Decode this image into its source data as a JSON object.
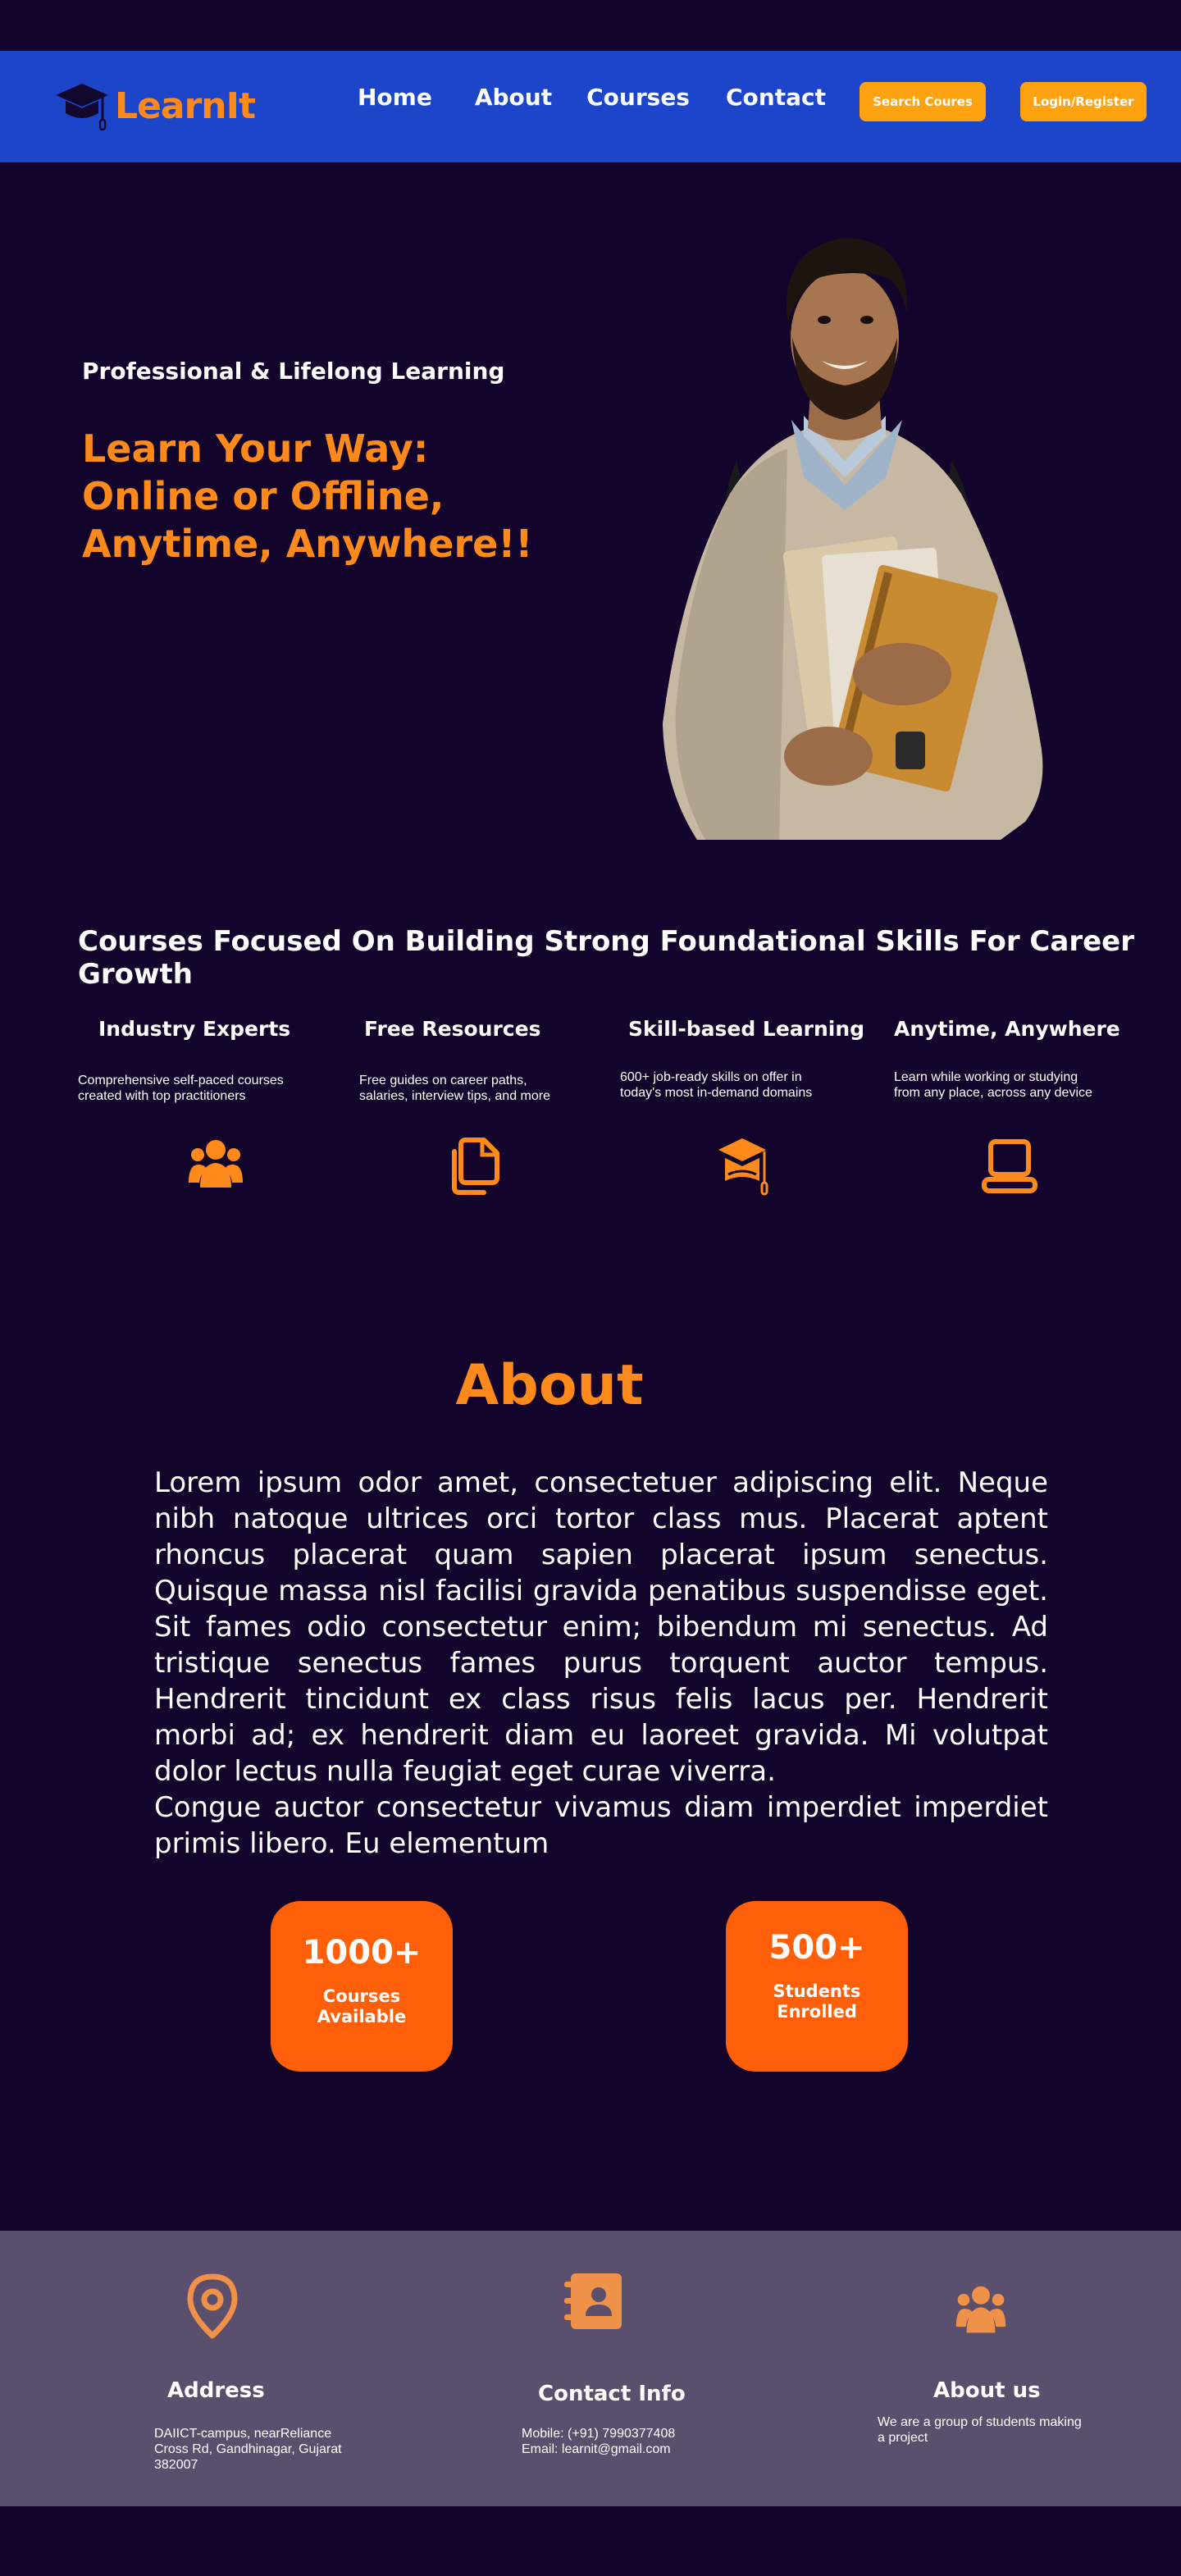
{
  "brand": {
    "name": "LearnIt",
    "accent": "#ff8a1c",
    "navbar_color": "#1c45c9",
    "background": "#12042b"
  },
  "nav": {
    "links": [
      "Home",
      "About",
      "Courses",
      "Contact"
    ],
    "search_button": "Search Coures",
    "login_button": "Login/Register"
  },
  "hero": {
    "subtitle": "Professional & Lifelong Learning",
    "title_lines": [
      "Learn Your Way:",
      "Online or Offline,",
      "Anytime, Anywhere!!"
    ],
    "image": "student-holding-books-photo"
  },
  "features": {
    "heading": "Courses Focused On Building Strong Foundational Skills For Career Growth",
    "items": [
      {
        "title": "Industry Experts",
        "desc_lines": [
          "Comprehensive self-paced courses",
          "created with top practitioners"
        ],
        "icon": "users-icon"
      },
      {
        "title": "Free Resources",
        "desc_lines": [
          "Free guides on career paths,",
          "salaries, interview tips, and more"
        ],
        "icon": "copy-icon"
      },
      {
        "title": "Skill-based Learning",
        "desc_lines": [
          "600+ job-ready skills on offer in",
          "today's most in-demand domains"
        ],
        "icon": "graduation-book-icon"
      },
      {
        "title": "Anytime, Anywhere",
        "desc_lines": [
          "Learn while working or studying",
          "from any place, across any device"
        ],
        "icon": "laptop-icon"
      }
    ]
  },
  "about": {
    "title": "About",
    "paragraph1": "Lorem ipsum odor amet, consectetuer adipiscing elit. Neque nibh natoque ultrices orci tortor class mus. Placerat aptent rhoncus placerat quam sapien placerat ipsum senectus. Quisque massa nisl facilisi gravida penatibus suspendisse eget. Sit fames odio consectetur enim; bibendum mi senectus. Ad tristique senectus fames purus torquent auctor tempus. Hendrerit tincidunt ex class risus felis lacus per. Hendrerit morbi ad; ex hendrerit diam eu laoreet gravida. Mi volutpat dolor lectus nulla feugiat eget curae viverra.",
    "paragraph2": "Congue auctor consectetur vivamus diam imperdiet imperdiet primis libero. Eu elementum",
    "stats": [
      {
        "value": "1000+",
        "label_lines": [
          "Courses",
          "Available"
        ]
      },
      {
        "value": "500+",
        "label_lines": [
          "Students",
          "Enrolled"
        ]
      }
    ],
    "stat_color": "#ff5f08"
  },
  "footer": {
    "background": "#5a4f6c",
    "address": {
      "title": "Address",
      "lines": [
        "DAIICT-campus, nearReliance",
        "Cross Rd, Gandhinagar, Gujarat",
        "382007"
      ],
      "icon": "location-pin-icon"
    },
    "contact": {
      "title": "Contact Info",
      "lines": [
        "Mobile: (+91) 7990377408",
        "Email: learnit@gmail.com"
      ],
      "icon": "contact-book-icon"
    },
    "about_us": {
      "title": "About us",
      "lines": [
        "We are a group of students making",
        "a project"
      ],
      "icon": "users-icon"
    }
  }
}
